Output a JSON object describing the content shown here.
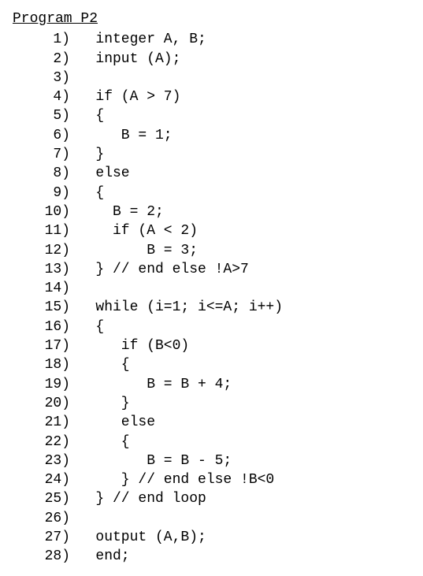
{
  "title": "Program P2",
  "lines": [
    {
      "n": "1",
      "code": " integer A, B;"
    },
    {
      "n": "2",
      "code": " input (A);"
    },
    {
      "n": "3",
      "code": ""
    },
    {
      "n": "4",
      "code": " if (A > 7)"
    },
    {
      "n": "5",
      "code": " {"
    },
    {
      "n": "6",
      "code": "    B = 1;"
    },
    {
      "n": "7",
      "code": " }"
    },
    {
      "n": "8",
      "code": " else"
    },
    {
      "n": "9",
      "code": " {"
    },
    {
      "n": "10",
      "code": "   B = 2;"
    },
    {
      "n": "11",
      "code": "   if (A < 2)"
    },
    {
      "n": "12",
      "code": "       B = 3;"
    },
    {
      "n": "13",
      "code": " } // end else !A>7"
    },
    {
      "n": "14",
      "code": ""
    },
    {
      "n": "15",
      "code": " while (i=1; i<=A; i++)"
    },
    {
      "n": "16",
      "code": " {"
    },
    {
      "n": "17",
      "code": "    if (B<0)"
    },
    {
      "n": "18",
      "code": "    {"
    },
    {
      "n": "19",
      "code": "       B = B + 4;"
    },
    {
      "n": "20",
      "code": "    }"
    },
    {
      "n": "21",
      "code": "    else"
    },
    {
      "n": "22",
      "code": "    {"
    },
    {
      "n": "23",
      "code": "       B = B - 5;"
    },
    {
      "n": "24",
      "code": "    } // end else !B<0"
    },
    {
      "n": "25",
      "code": " } // end loop"
    },
    {
      "n": "26",
      "code": ""
    },
    {
      "n": "27",
      "code": " output (A,B);"
    },
    {
      "n": "28",
      "code": " end;"
    }
  ]
}
